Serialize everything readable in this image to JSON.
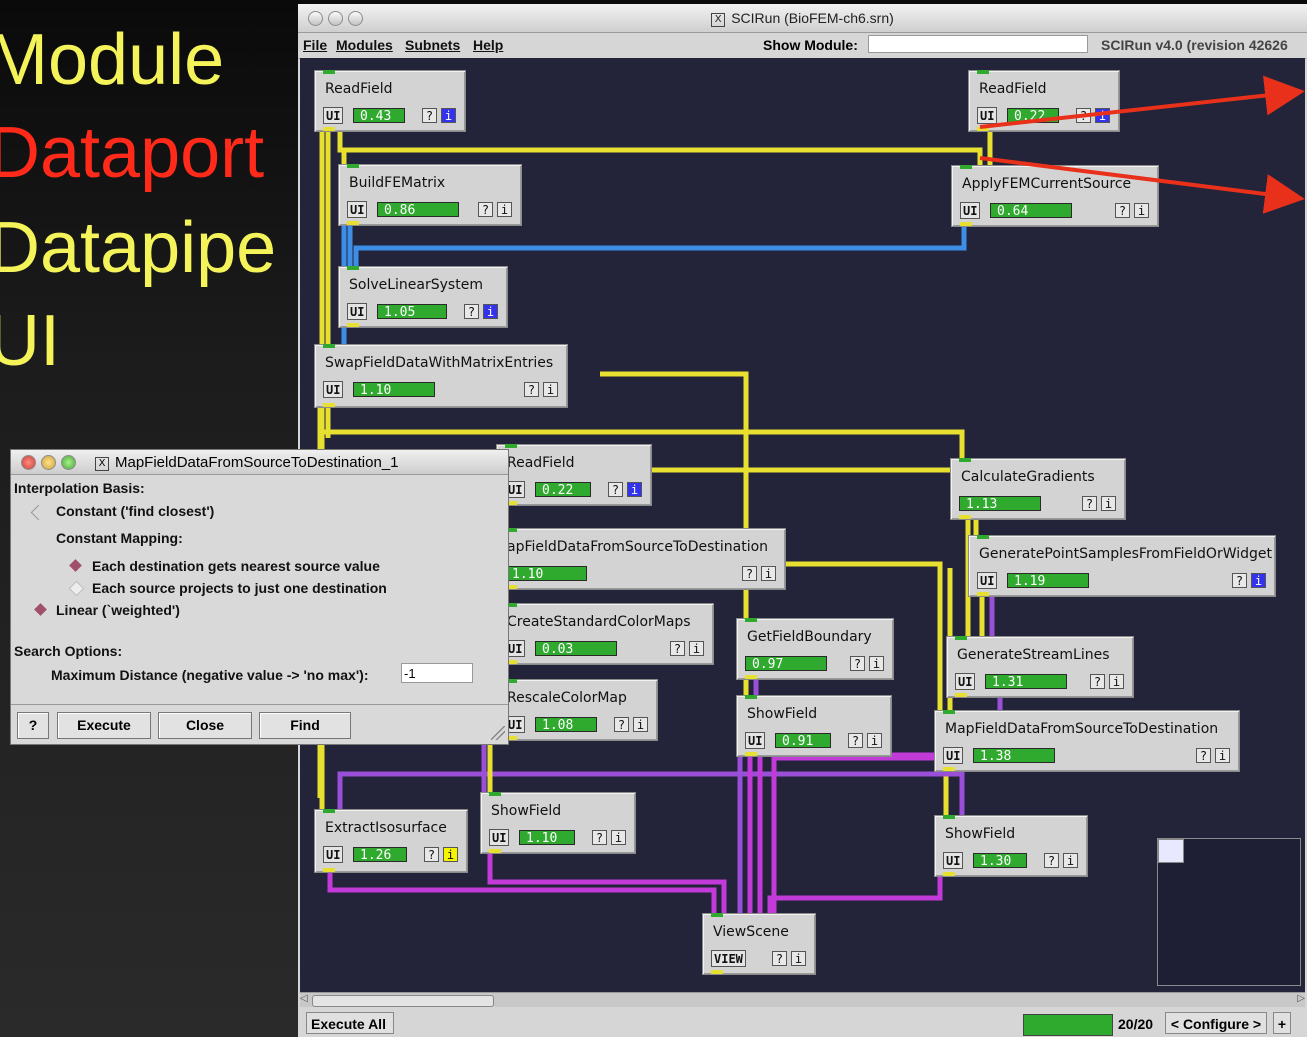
{
  "slide": {
    "bullets": [
      {
        "text": "Module",
        "color": "#f4f45a"
      },
      {
        "text": "Dataport",
        "color": "#ff2a1a"
      },
      {
        "text": "Datapipe",
        "color": "#f4f45a"
      },
      {
        "text": "UI",
        "color": "#f4f45a"
      }
    ]
  },
  "window": {
    "title": "SCIRun (BioFEM-ch6.srn)",
    "menu": [
      "File",
      "Modules",
      "Subnets",
      "Help"
    ],
    "show_module_label": "Show Module:",
    "show_module_value": "",
    "version": "SCIRun v4.0 (revision 42626"
  },
  "modules": [
    {
      "name": "ReadField",
      "ui": "UI",
      "time": "0.43",
      "info": "blue"
    },
    {
      "name": "BuildFEMatrix",
      "ui": "UI",
      "time": "0.86",
      "info": "plain"
    },
    {
      "name": "SolveLinearSystem",
      "ui": "UI",
      "time": "1.05",
      "info": "blue"
    },
    {
      "name": "SwapFieldDataWithMatrixEntries",
      "ui": "UI",
      "time": "1.10",
      "info": "plain"
    },
    {
      "name": "ReadField",
      "ui": "UI",
      "time": "0.22",
      "info": "blue"
    },
    {
      "name": "ApplyFEMCurrentSource",
      "ui": "UI",
      "time": "0.64",
      "info": "plain"
    },
    {
      "name": "ReadField",
      "ui": "UI",
      "time": "0.22",
      "info": "blue"
    },
    {
      "name": "apFieldDataFromSourceToDestination",
      "ui": "",
      "time": "1.10",
      "info": "plain"
    },
    {
      "name": "CreateStandardColorMaps",
      "ui": "UI",
      "time": "0.03",
      "info": "plain"
    },
    {
      "name": "RescaleColorMap",
      "ui": "UI",
      "time": "1.08",
      "info": "plain"
    },
    {
      "name": "CalculateGradients",
      "ui": "",
      "time": "1.13",
      "info": "plain"
    },
    {
      "name": "GeneratePointSamplesFromFieldOrWidget",
      "ui": "UI",
      "time": "1.19",
      "info": "blue"
    },
    {
      "name": "GetFieldBoundary",
      "ui": "",
      "time": "0.97",
      "info": "plain"
    },
    {
      "name": "GenerateStreamLines",
      "ui": "UI",
      "time": "1.31",
      "info": "plain"
    },
    {
      "name": "ShowField",
      "ui": "UI",
      "time": "0.91",
      "info": "plain"
    },
    {
      "name": "MapFieldDataFromSourceToDestination",
      "ui": "UI",
      "time": "1.38",
      "info": "plain"
    },
    {
      "name": "ExtractIsosurface",
      "ui": "UI",
      "time": "1.26",
      "info": "yellow"
    },
    {
      "name": "ShowField",
      "ui": "UI",
      "time": "1.10",
      "info": "plain"
    },
    {
      "name": "ShowField",
      "ui": "UI",
      "time": "1.30",
      "info": "plain"
    },
    {
      "name": "ViewScene",
      "ui": "VIEW",
      "time": "",
      "info": "plain"
    }
  ],
  "module_buttons": {
    "help": "?",
    "info": "i"
  },
  "dialog": {
    "title": "MapFieldDataFromSourceToDestination_1",
    "interpolation_basis": "Interpolation Basis:",
    "constant_option": "Constant ('find closest')",
    "constant_mapping": "Constant Mapping:",
    "each_destination": "Each destination gets nearest source value",
    "each_source": "Each source projects to just one destination",
    "linear_option": "Linear (`weighted')",
    "search_options": "Search Options:",
    "max_distance_label": "Maximum Distance (negative value -> 'no max'):",
    "max_distance_value": "-1",
    "buttons": {
      "help": "?",
      "execute": "Execute",
      "close": "Close",
      "find": "Find"
    }
  },
  "status": {
    "execute_all": "Execute All",
    "progress": "20/20",
    "configure": "< Configure >",
    "plus": "+"
  },
  "colors": {
    "canvas": "#23243a",
    "pipe_yellow": "#e8e030",
    "pipe_blue": "#3d8ee6",
    "pipe_purple": "#9a4fd8",
    "pipe_magenta": "#c23ad8",
    "progress_green": "#2faa2f",
    "annotation_red": "#e8301a"
  }
}
